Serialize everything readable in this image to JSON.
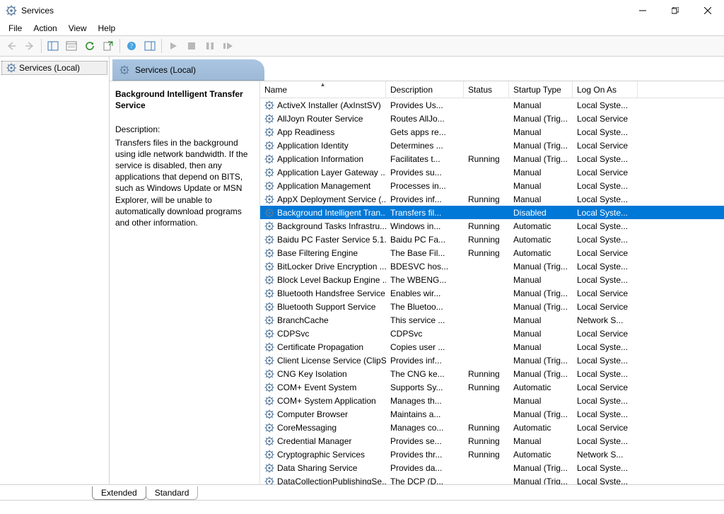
{
  "window": {
    "title": "Services"
  },
  "menu": [
    "File",
    "Action",
    "View",
    "Help"
  ],
  "tree": {
    "root": "Services (Local)"
  },
  "pane_header": "Services (Local)",
  "detail": {
    "selected_name": "Background Intelligent Transfer Service",
    "desc_label": "Description:",
    "description": "Transfers files in the background using idle network bandwidth. If the service is disabled, then any applications that depend on BITS, such as Windows Update or MSN Explorer, will be unable to automatically download programs and other information."
  },
  "columns": {
    "name": "Name",
    "description": "Description",
    "status": "Status",
    "startup": "Startup Type",
    "logon": "Log On As",
    "sort": "name_asc"
  },
  "tabs": {
    "extended": "Extended",
    "standard": "Standard",
    "active": "extended"
  },
  "services": [
    {
      "name": "ActiveX Installer (AxInstSV)",
      "desc": "Provides Us...",
      "status": "",
      "startup": "Manual",
      "logon": "Local Syste..."
    },
    {
      "name": "AllJoyn Router Service",
      "desc": "Routes AllJo...",
      "status": "",
      "startup": "Manual (Trig...",
      "logon": "Local Service"
    },
    {
      "name": "App Readiness",
      "desc": "Gets apps re...",
      "status": "",
      "startup": "Manual",
      "logon": "Local Syste..."
    },
    {
      "name": "Application Identity",
      "desc": "Determines ...",
      "status": "",
      "startup": "Manual (Trig...",
      "logon": "Local Service"
    },
    {
      "name": "Application Information",
      "desc": "Facilitates t...",
      "status": "Running",
      "startup": "Manual (Trig...",
      "logon": "Local Syste..."
    },
    {
      "name": "Application Layer Gateway ...",
      "desc": "Provides su...",
      "status": "",
      "startup": "Manual",
      "logon": "Local Service"
    },
    {
      "name": "Application Management",
      "desc": "Processes in...",
      "status": "",
      "startup": "Manual",
      "logon": "Local Syste..."
    },
    {
      "name": "AppX Deployment Service (...",
      "desc": "Provides inf...",
      "status": "Running",
      "startup": "Manual",
      "logon": "Local Syste..."
    },
    {
      "name": "Background Intelligent Tran...",
      "desc": "Transfers fil...",
      "status": "",
      "startup": "Disabled",
      "logon": "Local Syste...",
      "selected": true
    },
    {
      "name": "Background Tasks Infrastru...",
      "desc": "Windows in...",
      "status": "Running",
      "startup": "Automatic",
      "logon": "Local Syste..."
    },
    {
      "name": "Baidu PC Faster Service 5.1....",
      "desc": "Baidu PC Fa...",
      "status": "Running",
      "startup": "Automatic",
      "logon": "Local Syste..."
    },
    {
      "name": "Base Filtering Engine",
      "desc": "The Base Fil...",
      "status": "Running",
      "startup": "Automatic",
      "logon": "Local Service"
    },
    {
      "name": "BitLocker Drive Encryption ...",
      "desc": "BDESVC hos...",
      "status": "",
      "startup": "Manual (Trig...",
      "logon": "Local Syste..."
    },
    {
      "name": "Block Level Backup Engine ...",
      "desc": "The WBENG...",
      "status": "",
      "startup": "Manual",
      "logon": "Local Syste..."
    },
    {
      "name": "Bluetooth Handsfree Service",
      "desc": "Enables wir...",
      "status": "",
      "startup": "Manual (Trig...",
      "logon": "Local Service"
    },
    {
      "name": "Bluetooth Support Service",
      "desc": "The Bluetoo...",
      "status": "",
      "startup": "Manual (Trig...",
      "logon": "Local Service"
    },
    {
      "name": "BranchCache",
      "desc": "This service ...",
      "status": "",
      "startup": "Manual",
      "logon": "Network S..."
    },
    {
      "name": "CDPSvc",
      "desc": "CDPSvc",
      "status": "",
      "startup": "Manual",
      "logon": "Local Service"
    },
    {
      "name": "Certificate Propagation",
      "desc": "Copies user ...",
      "status": "",
      "startup": "Manual",
      "logon": "Local Syste..."
    },
    {
      "name": "Client License Service (ClipS...",
      "desc": "Provides inf...",
      "status": "",
      "startup": "Manual (Trig...",
      "logon": "Local Syste..."
    },
    {
      "name": "CNG Key Isolation",
      "desc": "The CNG ke...",
      "status": "Running",
      "startup": "Manual (Trig...",
      "logon": "Local Syste..."
    },
    {
      "name": "COM+ Event System",
      "desc": "Supports Sy...",
      "status": "Running",
      "startup": "Automatic",
      "logon": "Local Service"
    },
    {
      "name": "COM+ System Application",
      "desc": "Manages th...",
      "status": "",
      "startup": "Manual",
      "logon": "Local Syste..."
    },
    {
      "name": "Computer Browser",
      "desc": "Maintains a...",
      "status": "",
      "startup": "Manual (Trig...",
      "logon": "Local Syste..."
    },
    {
      "name": "CoreMessaging",
      "desc": "Manages co...",
      "status": "Running",
      "startup": "Automatic",
      "logon": "Local Service"
    },
    {
      "name": "Credential Manager",
      "desc": "Provides se...",
      "status": "Running",
      "startup": "Manual",
      "logon": "Local Syste..."
    },
    {
      "name": "Cryptographic Services",
      "desc": "Provides thr...",
      "status": "Running",
      "startup": "Automatic",
      "logon": "Network S..."
    },
    {
      "name": "Data Sharing Service",
      "desc": "Provides da...",
      "status": "",
      "startup": "Manual (Trig...",
      "logon": "Local Syste..."
    },
    {
      "name": "DataCollectionPublishingSe...",
      "desc": "The DCP (D...",
      "status": "",
      "startup": "Manual (Trig...",
      "logon": "Local Syste..."
    }
  ]
}
